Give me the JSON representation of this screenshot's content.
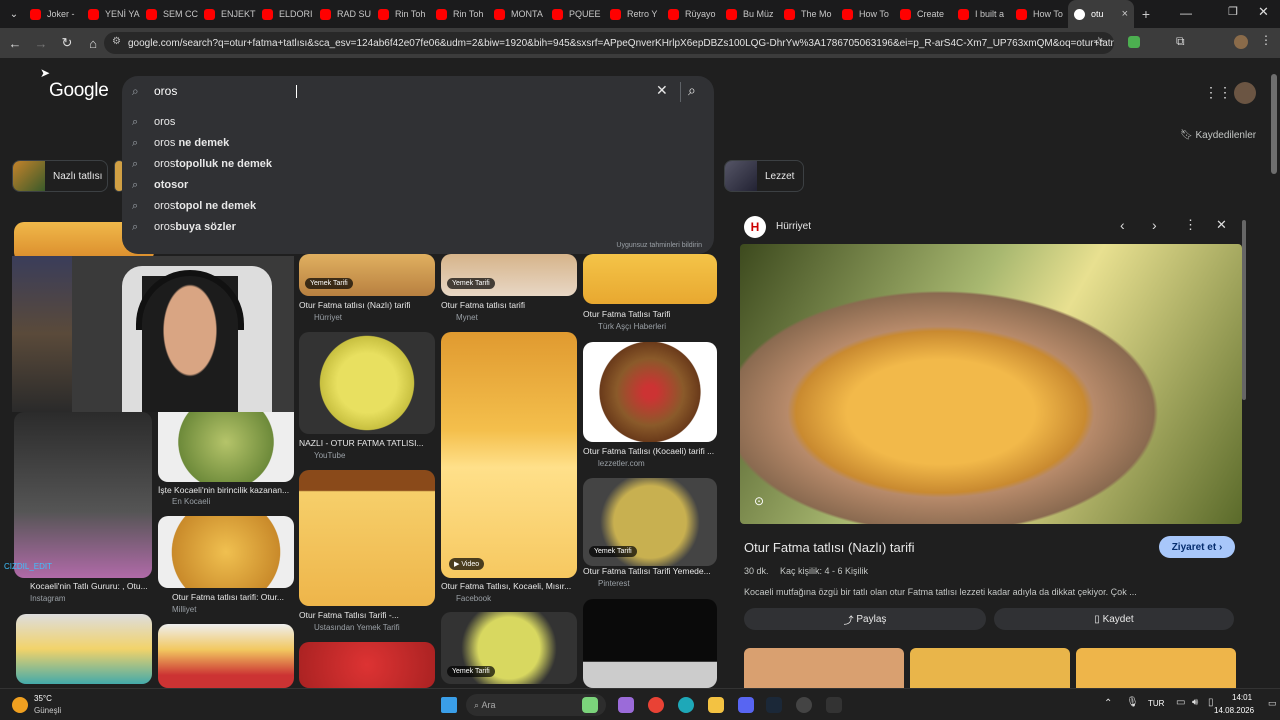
{
  "tabs": [
    {
      "label": "Joker -",
      "color": "#ff0000"
    },
    {
      "label": "YENİ YA",
      "color": "#ff0000"
    },
    {
      "label": "SEM CC",
      "color": "#ff0000"
    },
    {
      "label": "ENJEKTİ",
      "color": "#ff0000"
    },
    {
      "label": "ELDORI",
      "color": "#ff0000"
    },
    {
      "label": "RAD SU",
      "color": "#ff0000"
    },
    {
      "label": "Rin Toh",
      "color": "#ff0000"
    },
    {
      "label": "Rin Toh",
      "color": "#ff0000"
    },
    {
      "label": "MONTA",
      "color": "#ff0000"
    },
    {
      "label": "PQUEE",
      "color": "#ff0000"
    },
    {
      "label": "Retro Y",
      "color": "#ff0000"
    },
    {
      "label": "Rüyayo",
      "color": "#ff0000"
    },
    {
      "label": "Bu Müz",
      "color": "#ff0000"
    },
    {
      "label": "The Mo",
      "color": "#ff0000"
    },
    {
      "label": "How To",
      "color": "#ff0000"
    },
    {
      "label": "Create",
      "color": "#ff0000"
    },
    {
      "label": "I built a",
      "color": "#ff0000"
    },
    {
      "label": "How To",
      "color": "#ff0000"
    }
  ],
  "active_tab": {
    "label": "otu",
    "color": "#4285f4"
  },
  "url": "google.com/search?q=otur+fatma+tatlısı&sca_esv=124ab6f42e07fe06&udm=2&biw=1920&bih=945&sxsrf=APpeQnverKHrlpX6epDBZs100LQG-DhrYw%3A1786705063196&ei=p_R-arS4C-Xm7_UP763xmQM&oq=otur+fatm&gs_l...",
  "header": {
    "logo": "Google",
    "search_value": "oros",
    "saved_label": "Kaydedilenler"
  },
  "suggestions": [
    {
      "prefix": "oros",
      "rest": ""
    },
    {
      "prefix": "oros",
      "rest": " ne demek"
    },
    {
      "prefix": "oros",
      "rest": "topolluk ne demek"
    },
    {
      "prefix": "",
      "rest": "otosor"
    },
    {
      "prefix": "oros",
      "rest": "topol ne demek"
    },
    {
      "prefix": "oros",
      "rest": "buya sözler"
    }
  ],
  "report_label": "Uygunsuz tahminleri bildirin",
  "chips": [
    {
      "label": "Nazlı tatlısı"
    },
    {
      "label": "Lezzet"
    }
  ],
  "results": {
    "col2": [
      {
        "caption": "Otur Fatma tatlısı (Nazlı) tarifi",
        "source": "Hürriyet",
        "badge": "Yemek Tarifi"
      },
      {
        "caption": "NAZLI - OTUR FATMA TATLISI...",
        "source": "YouTube"
      },
      {
        "caption": "Otur Fatma Tatlısı Tarifi -...",
        "source": "Ustasından Yemek Tarifi"
      }
    ],
    "col3": [
      {
        "caption": "Otur Fatma tatlısı tarifi",
        "source": "Mynet",
        "badge": "Yemek Tarifi"
      },
      {
        "caption": "Otur Fatma Tatlısı, Kocaeli, Mısır...",
        "source": "Facebook",
        "badge": "Video"
      },
      {
        "caption": "",
        "source": "",
        "badge": "Yemek Tarifi"
      }
    ],
    "col4": [
      {
        "caption": "Otur Fatma Tatlısı Tarifi",
        "source": "Türk Aşçı Haberleri"
      },
      {
        "caption": "Otur Fatma Tatlısı (Kocaeli) tarifi ...",
        "source": "lezzetler.com"
      },
      {
        "caption": "Otur Fatma Tatlısı Tarifi Yemede...",
        "source": "Pinterest",
        "badge": "Yemek Tarifi"
      }
    ],
    "col1": [
      {
        "caption": "İşte Kocaeli'nin birincilik kazanan...",
        "source": "En Kocaeli"
      },
      {
        "caption": "Otur Fatma tatlısı tarifi: Otur...",
        "source": "Milliyet"
      },
      {
        "caption": "Kocaeli'nin Tatlı Gururu: , Otu...",
        "source": "Instagram"
      }
    ]
  },
  "panel": {
    "source": "Hürriyet",
    "title": "Otur Fatma tatlısı (Nazlı) tarifi",
    "visit_label": "Ziyaret et",
    "time": "30 dk.",
    "servings": "Kaç kişilik: 4 - 6 Kişilik",
    "description": "Kocaeli mutfağına özgü bir tatlı olan otur Fatma tatlısı lezzeti kadar adıyla da dikkat çekiyor. Çok ...",
    "share_label": "Paylaş",
    "save_label": "Kaydet"
  },
  "taskbar": {
    "weather_temp": "35°C",
    "weather_desc": "Güneşli",
    "search_placeholder": "Ara",
    "lang": "TUR",
    "time": "14:01",
    "date": "14.08.2026"
  },
  "watermark": "CIZDIL_EDIT"
}
